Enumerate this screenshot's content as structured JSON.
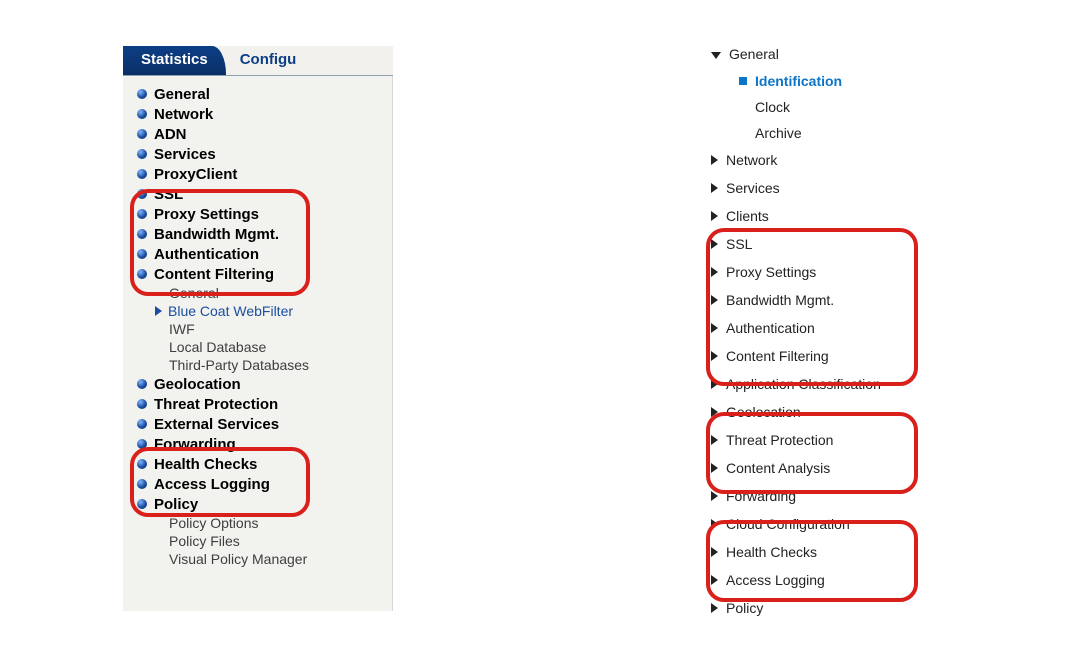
{
  "left": {
    "tabs": {
      "statistics": "Statistics",
      "configure": "Configu"
    },
    "items": [
      {
        "type": "node",
        "label": "General"
      },
      {
        "type": "node",
        "label": "Network"
      },
      {
        "type": "node",
        "label": "ADN"
      },
      {
        "type": "node",
        "label": "Services"
      },
      {
        "type": "node",
        "label": "ProxyClient"
      },
      {
        "type": "node",
        "label": "SSL"
      },
      {
        "type": "node",
        "label": "Proxy Settings"
      },
      {
        "type": "node",
        "label": "Bandwidth Mgmt."
      },
      {
        "type": "node",
        "label": "Authentication"
      },
      {
        "type": "node",
        "label": "Content Filtering"
      },
      {
        "type": "sub",
        "label": "General"
      },
      {
        "type": "sub",
        "label": "Blue Coat WebFilter",
        "active": true
      },
      {
        "type": "sub",
        "label": "IWF"
      },
      {
        "type": "sub",
        "label": "Local Database"
      },
      {
        "type": "sub",
        "label": "Third-Party Databases"
      },
      {
        "type": "node",
        "label": "Geolocation"
      },
      {
        "type": "node",
        "label": "Threat Protection"
      },
      {
        "type": "node",
        "label": "External Services"
      },
      {
        "type": "node",
        "label": "Forwarding"
      },
      {
        "type": "node",
        "label": "Health Checks"
      },
      {
        "type": "node",
        "label": "Access Logging"
      },
      {
        "type": "node",
        "label": "Policy"
      },
      {
        "type": "sub",
        "label": "Policy Options"
      },
      {
        "type": "sub",
        "label": "Policy Files"
      },
      {
        "type": "sub",
        "label": "Visual Policy Manager"
      }
    ]
  },
  "right": {
    "items": [
      {
        "type": "expanded",
        "label": "General"
      },
      {
        "type": "sub-active",
        "label": "Identification"
      },
      {
        "type": "sub-plain",
        "label": "Clock"
      },
      {
        "type": "sub-plain",
        "label": "Archive"
      },
      {
        "type": "collapsed",
        "label": "Network"
      },
      {
        "type": "collapsed",
        "label": "Services"
      },
      {
        "type": "collapsed",
        "label": "Clients"
      },
      {
        "type": "collapsed",
        "label": "SSL"
      },
      {
        "type": "collapsed",
        "label": "Proxy Settings"
      },
      {
        "type": "collapsed",
        "label": "Bandwidth Mgmt."
      },
      {
        "type": "collapsed",
        "label": "Authentication"
      },
      {
        "type": "collapsed",
        "label": "Content Filtering"
      },
      {
        "type": "collapsed",
        "label": "Application Classification"
      },
      {
        "type": "collapsed",
        "label": "Geolocation"
      },
      {
        "type": "collapsed",
        "label": "Threat Protection"
      },
      {
        "type": "collapsed",
        "label": "Content Analysis"
      },
      {
        "type": "collapsed",
        "label": "Forwarding"
      },
      {
        "type": "collapsed",
        "label": "Cloud Configuration"
      },
      {
        "type": "collapsed",
        "label": "Health Checks"
      },
      {
        "type": "collapsed",
        "label": "Access Logging"
      },
      {
        "type": "collapsed",
        "label": "Policy"
      }
    ]
  }
}
